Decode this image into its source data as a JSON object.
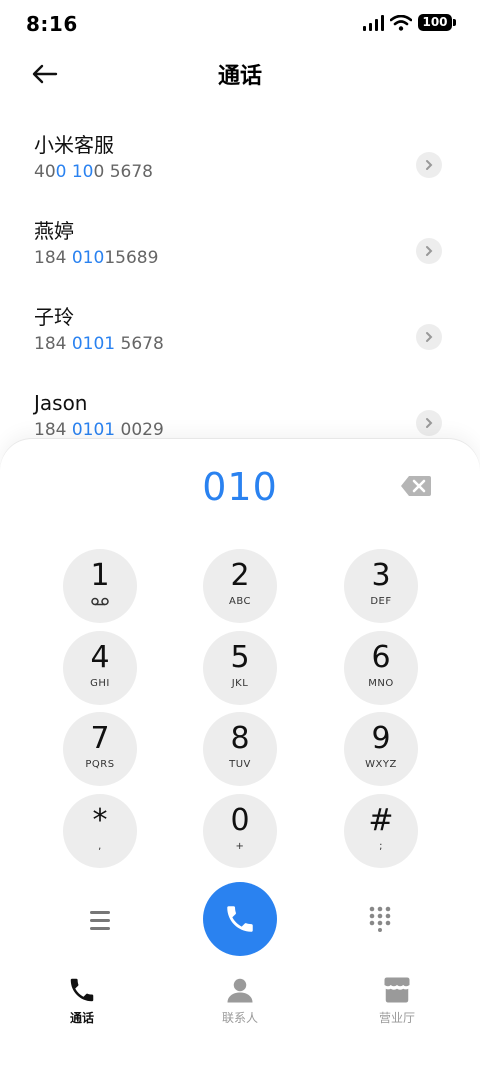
{
  "status_bar": {
    "time": "8:16",
    "battery": "100"
  },
  "header": {
    "title": "通话"
  },
  "contacts": [
    {
      "name": "小米客服",
      "number_parts": [
        "40",
        "0 10",
        "0 5678"
      ]
    },
    {
      "name": "燕婷",
      "number_parts": [
        "184 ",
        "010",
        "15689"
      ]
    },
    {
      "name": "子玲",
      "number_parts": [
        "184 ",
        "0101",
        " 5678"
      ]
    },
    {
      "name": "Jason",
      "number_parts": [
        "184 ",
        "0101",
        " 0029"
      ]
    }
  ],
  "dialer": {
    "input": "010",
    "keys": [
      {
        "digit": "1",
        "letters": ""
      },
      {
        "digit": "2",
        "letters": "ABC"
      },
      {
        "digit": "3",
        "letters": "DEF"
      },
      {
        "digit": "4",
        "letters": "GHI"
      },
      {
        "digit": "5",
        "letters": "JKL"
      },
      {
        "digit": "6",
        "letters": "MNO"
      },
      {
        "digit": "7",
        "letters": "PQRS"
      },
      {
        "digit": "8",
        "letters": "TUV"
      },
      {
        "digit": "9",
        "letters": "WXYZ"
      },
      {
        "digit": "*",
        "letters": ","
      },
      {
        "digit": "0",
        "letters": "+"
      },
      {
        "digit": "#",
        "letters": ";"
      }
    ]
  },
  "tabs": [
    {
      "label": "通话",
      "icon": "phone-icon",
      "active": true
    },
    {
      "label": "联系人",
      "icon": "person-icon",
      "active": false
    },
    {
      "label": "营业厅",
      "icon": "store-icon",
      "active": false
    }
  ],
  "colors": {
    "accent": "#2a82f0",
    "key_bg": "#ededed"
  }
}
